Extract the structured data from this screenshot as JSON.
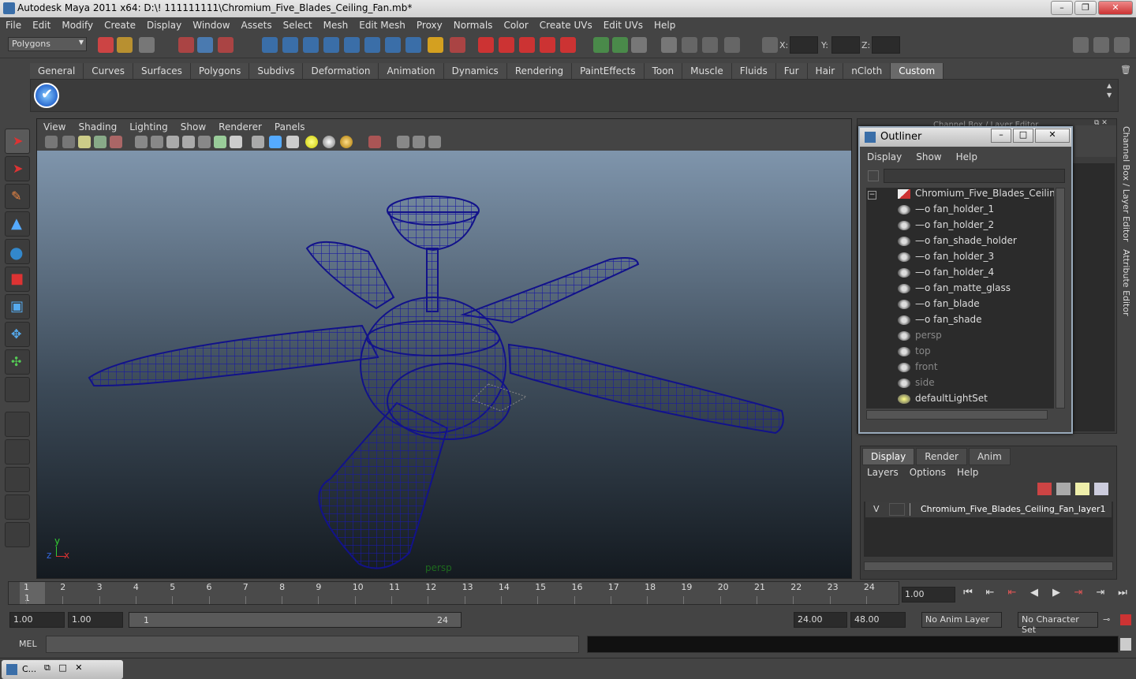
{
  "window": {
    "title": "Autodesk Maya 2011 x64: D:\\! 111111111\\Chromium_Five_Blades_Ceiling_Fan.mb*"
  },
  "menubar": [
    "File",
    "Edit",
    "Modify",
    "Create",
    "Display",
    "Window",
    "Assets",
    "Select",
    "Mesh",
    "Edit Mesh",
    "Proxy",
    "Normals",
    "Color",
    "Create UVs",
    "Edit UVs",
    "Help"
  ],
  "toolbar": {
    "mode": "Polygons",
    "x_label": "X:",
    "y_label": "Y:",
    "z_label": "Z:"
  },
  "shelf_tabs": [
    "General",
    "Curves",
    "Surfaces",
    "Polygons",
    "Subdivs",
    "Deformation",
    "Animation",
    "Dynamics",
    "Rendering",
    "PaintEffects",
    "Toon",
    "Muscle",
    "Fluids",
    "Fur",
    "Hair",
    "nCloth",
    "Custom"
  ],
  "shelf_active": "Custom",
  "viewport": {
    "menus": [
      "View",
      "Shading",
      "Lighting",
      "Show",
      "Renderer",
      "Panels"
    ],
    "camera_label": "persp",
    "axis": {
      "y": "y",
      "x": "x",
      "z": "z"
    }
  },
  "right_panel": {
    "header": "Channel Box / Layer Editor",
    "side_tabs": [
      "Channel Box / Layer Editor",
      "Attribute Editor"
    ]
  },
  "outliner": {
    "title": "Outliner",
    "menus": [
      "Display",
      "Show",
      "Help"
    ],
    "root": "Chromium_Five_Blades_Ceiling_Fan",
    "children": [
      "fan_holder_1",
      "fan_holder_2",
      "fan_shade_holder",
      "fan_holder_3",
      "fan_holder_4",
      "fan_matte_glass",
      "fan_blade",
      "fan_shade"
    ],
    "cameras": [
      "persp",
      "top",
      "front",
      "side"
    ],
    "sets": [
      "defaultLightSet"
    ]
  },
  "layers": {
    "tabs": [
      "Display",
      "Render",
      "Anim"
    ],
    "active_tab": "Display",
    "menus": [
      "Layers",
      "Options",
      "Help"
    ],
    "rows": [
      {
        "visible": "V",
        "name": "Chromium_Five_Blades_Ceiling_Fan_layer1"
      }
    ]
  },
  "timeline": {
    "ticks": [
      "1",
      "2",
      "3",
      "4",
      "5",
      "6",
      "7",
      "8",
      "9",
      "10",
      "11",
      "12",
      "13",
      "14",
      "15",
      "16",
      "17",
      "18",
      "19",
      "20",
      "21",
      "22",
      "23",
      "24"
    ],
    "current_frame_label": "1",
    "current_time": "1.00"
  },
  "range": {
    "start": "1.00",
    "playback_start": "1.00",
    "slider_start": "1",
    "slider_end": "24",
    "playback_end": "24.00",
    "end": "48.00",
    "anim_layer": "No Anim Layer",
    "character_set": "No Character Set"
  },
  "mel": {
    "label": "MEL"
  },
  "taskbar": {
    "item": "C..."
  }
}
